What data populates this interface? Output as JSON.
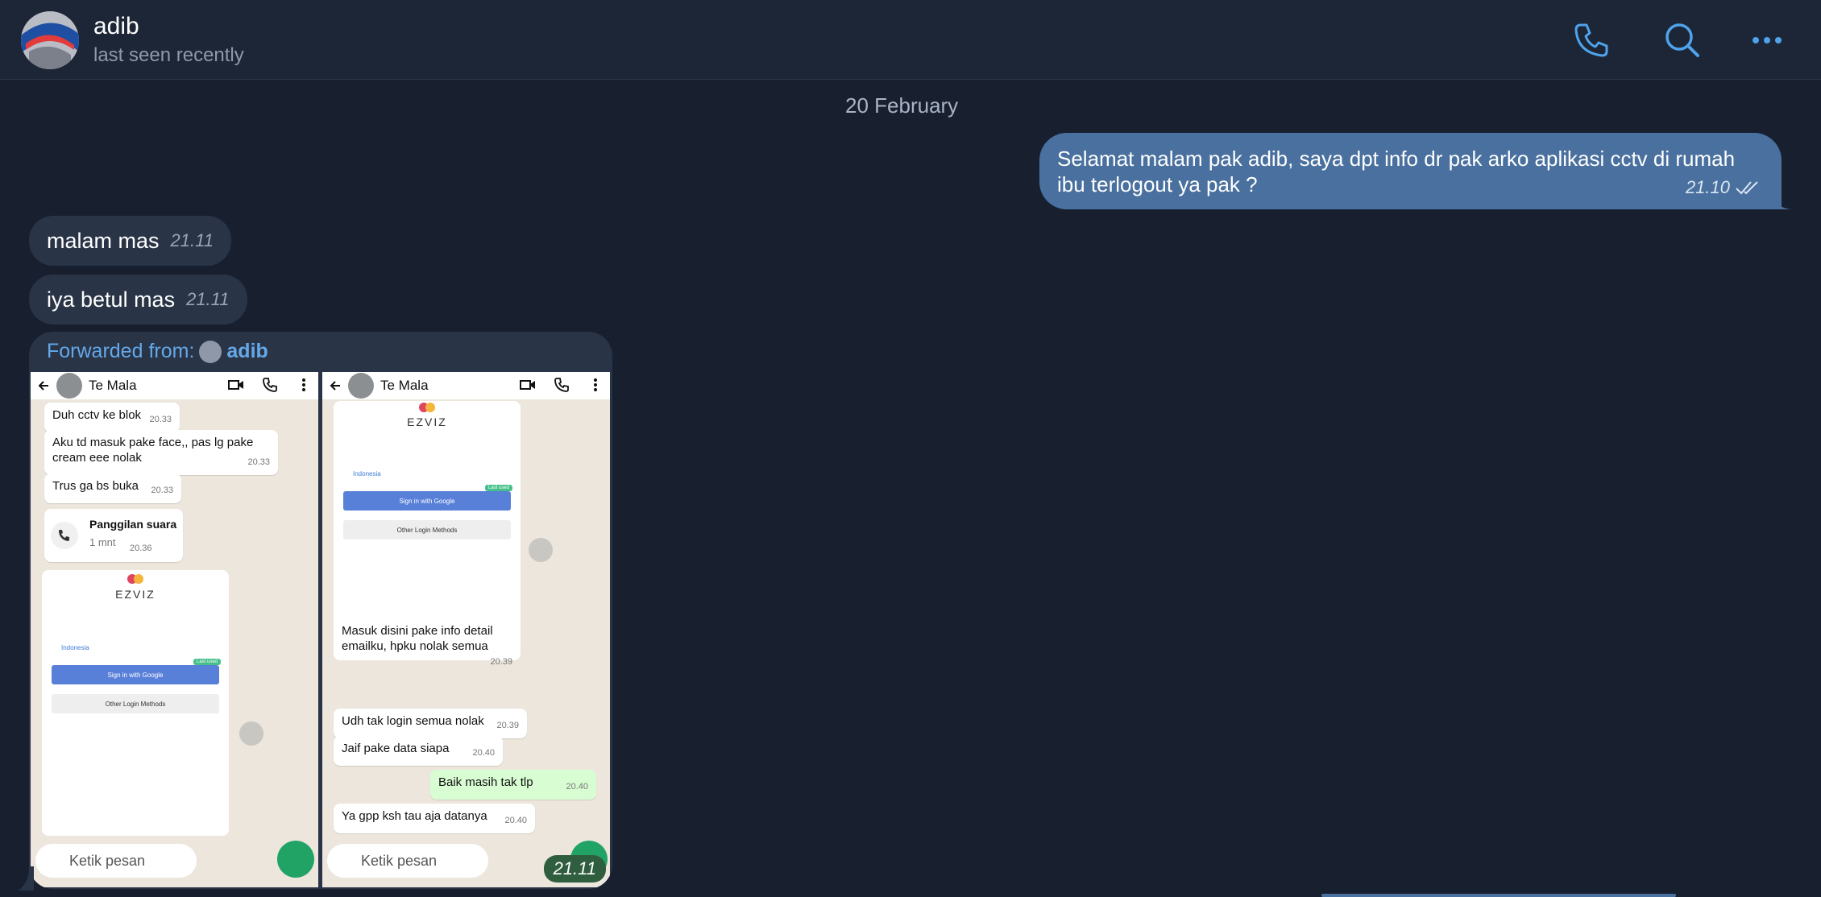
{
  "header": {
    "name": "adib",
    "status": "last seen recently"
  },
  "icons": {
    "call": "phone-icon",
    "search": "search-icon",
    "more": "more-icon"
  },
  "date": "20 February",
  "outgoing": {
    "text": "Selamat malam pak adib, saya dpt info dr pak arko aplikasi cctv di rumah\nibu terlogout ya pak ?",
    "time": "21.10"
  },
  "incoming": [
    {
      "text": "malam mas",
      "time": "21.11"
    },
    {
      "text": "iya betul mas",
      "time": "21.11"
    }
  ],
  "forwarded": {
    "prefix": "Forwarded from:",
    "from": "adib",
    "time": "21.11"
  },
  "shot_left": {
    "contact": "Te Mala",
    "msgs": [
      {
        "text": "Duh cctv ke blok",
        "time": "20.33"
      },
      {
        "text": "Aku td masuk pake face,, pas lg pake cream eee nolak",
        "time": "20.33"
      },
      {
        "text": "Trus ga bs buka",
        "time": "20.33"
      }
    ],
    "call": {
      "title": "Panggilan suara",
      "sub": "1 mnt",
      "time": "20.36"
    },
    "ezviz": {
      "logo": "EZVIZ",
      "location": "Indonesia",
      "google": "Sign in with Google",
      "other": "Other Login Methods",
      "last": "Last used"
    },
    "input_placeholder": "Ketik pesan"
  },
  "shot_right": {
    "contact": "Te Mala",
    "ezviz": {
      "logo": "EZVIZ",
      "location": "Indonesia",
      "google": "Sign in with Google",
      "other": "Other Login Methods",
      "last": "Last used"
    },
    "caption": {
      "text": "Masuk disini pake info detail emailku, hpku nolak semua",
      "time": "20.39"
    },
    "msgs": [
      {
        "text": "Udh tak login semua nolak",
        "time": "20.39"
      },
      {
        "text": "Jaif pake data siapa",
        "time": "20.40"
      },
      {
        "text": "Baik masih tak tlp",
        "time": "20.40"
      },
      {
        "text": "Ya gpp ksh tau aja datanya",
        "time": "20.40"
      }
    ],
    "input_placeholder": "Ketik pesan"
  },
  "colors": {
    "background": "#182030",
    "header": "#1d2636",
    "outgoing": "#49709e",
    "incoming": "#293447",
    "accent": "#4ea3ec"
  }
}
